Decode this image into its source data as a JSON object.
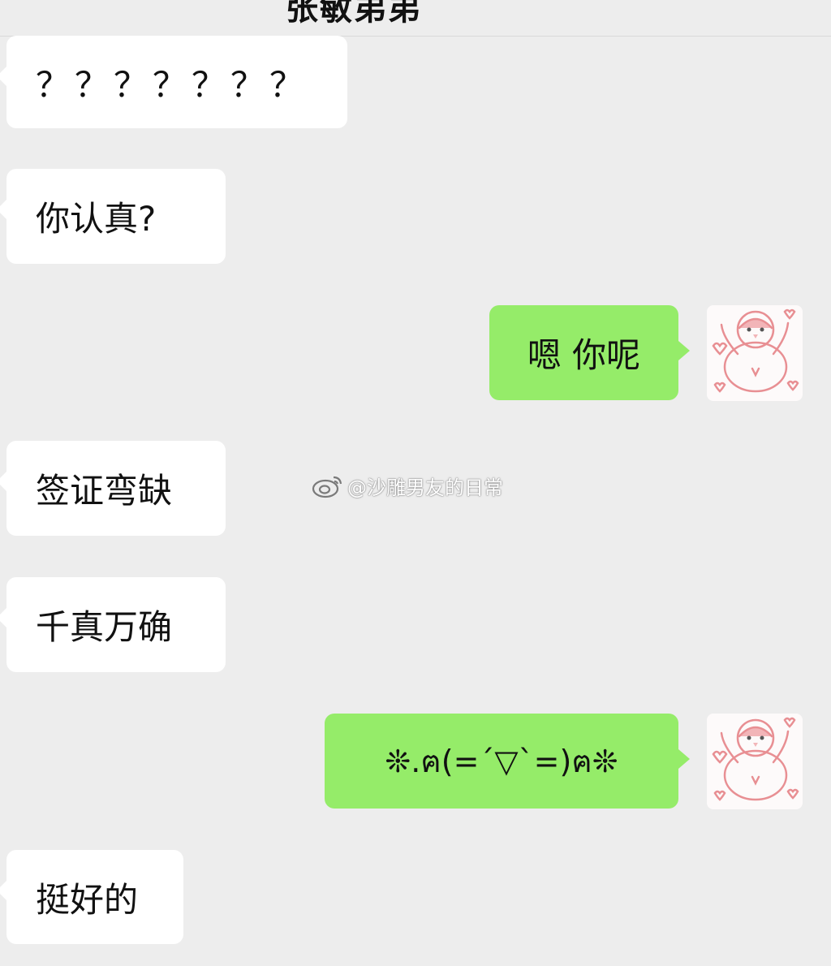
{
  "header": {
    "title": "张敏弟弟"
  },
  "watermark": {
    "text": "@沙雕男友的日常",
    "icon": "weibo-icon"
  },
  "messages": [
    {
      "side": "left",
      "text": "？？？？？？？"
    },
    {
      "side": "left",
      "text": "你认真?"
    },
    {
      "side": "right",
      "text": "嗯 你呢",
      "avatar": "penguin-avatar"
    },
    {
      "side": "left",
      "text": "签证弯缺"
    },
    {
      "side": "left",
      "text": "千真万确"
    },
    {
      "side": "right",
      "text": "❊.ฅ(=´▽`=)ฅ❊",
      "avatar": "penguin-avatar"
    },
    {
      "side": "left",
      "text": "挺好的"
    }
  ],
  "colors": {
    "background": "#ededed",
    "incoming_bubble": "#ffffff",
    "outgoing_bubble": "#95ec69",
    "avatar_tint": "#e88f93"
  }
}
